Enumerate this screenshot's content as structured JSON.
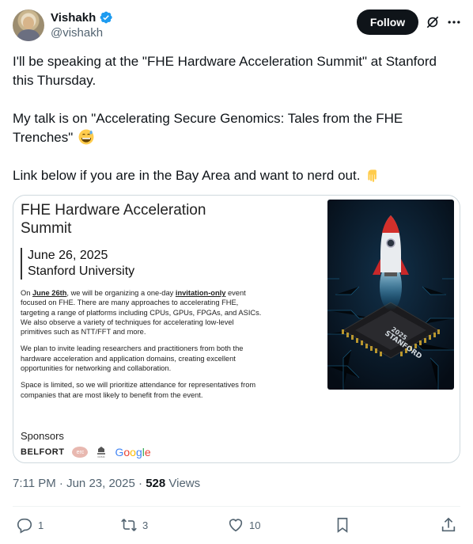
{
  "author": {
    "name": "Vishakh",
    "handle": "@vishakh",
    "verified": true
  },
  "follow_label": "Follow",
  "tweet": {
    "line1": "I'll be speaking at the \"FHE Hardware Acceleration Summit\" at Stanford this Thursday.",
    "line2": "My talk is on \"Accelerating Secure Genomics: Tales from the FHE Trenches\"",
    "line2_emoji": "grinning-sweat-emoji",
    "line3": "Link below if you are in the Bay Area and want to nerd out.",
    "line3_emoji": "pointing-down-emoji"
  },
  "flyer": {
    "title": "FHE Hardware Acceleration Summit",
    "date": "June 26, 2025",
    "location": "Stanford University",
    "para1_prefix": "On ",
    "para1_date": "June 26th",
    "para1_mid": ", we will be organizing a one-day ",
    "para1_bold": "invitation-only",
    "para1_rest": " event focused on FHE. There are many approaches to accelerating FHE, targeting a range of platforms including CPUs, GPUs, FPGAs, and ASICs. We also observe a variety of techniques for accelerating low-level primitives such as NTT/FFT and more.",
    "para2": "We plan to invite leading researchers and practitioners from both the hardware acceleration and application domains, creating excellent opportunities for networking and collaboration.",
    "para3": "Space is limited, so we will prioritize attendance for representatives from companies that are most likely to benefit from the event.",
    "sponsors_label": "Sponsors",
    "sponsors": [
      "BELFORT",
      "erc",
      "COSIC",
      "Google"
    ],
    "chip_label_1": "STANFORD",
    "chip_label_2": "2025"
  },
  "meta": {
    "time": "7:11 PM",
    "date": "Jun 23, 2025",
    "views_count": "528",
    "views_label": "Views"
  },
  "actions": {
    "replies": "1",
    "reposts": "3",
    "likes": "10"
  },
  "colors": {
    "text": "#0f1419",
    "secondary": "#536471",
    "verified": "#1d9bf0",
    "border": "#cfd9de"
  }
}
